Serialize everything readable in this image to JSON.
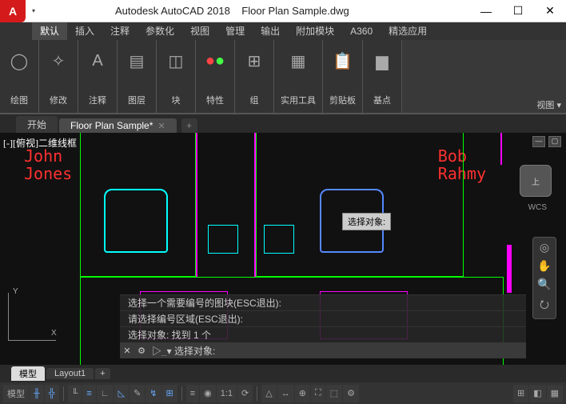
{
  "title": {
    "app": "Autodesk AutoCAD 2018",
    "file": "Floor Plan Sample.dwg"
  },
  "menu": [
    "默认",
    "插入",
    "注释",
    "参数化",
    "视图",
    "管理",
    "输出",
    "附加模块",
    "A360",
    "精选应用"
  ],
  "ribbon": {
    "groups": [
      {
        "label": "绘图"
      },
      {
        "label": "修改"
      },
      {
        "label": "注释"
      },
      {
        "label": "图层"
      },
      {
        "label": "块"
      },
      {
        "label": "特性"
      },
      {
        "label": "组"
      },
      {
        "label": "实用工具"
      },
      {
        "label": "剪贴板"
      },
      {
        "label": "基点"
      }
    ],
    "panel_dd": "视图 ▾"
  },
  "doctabs": {
    "start": "开始",
    "active": "Floor Plan Sample*",
    "add": "+"
  },
  "canvas": {
    "viewtag": "[-][俯视]二维线框",
    "name1": "John\nJones",
    "name2": "Bob\nRahmy",
    "tooltip": "选择对象:",
    "wcs": "WCS",
    "cube": "上",
    "ucs_x": "X",
    "ucs_y": "Y"
  },
  "cmd": {
    "h1": "选择一个需要编号的图块(ESC退出):",
    "h2": "请选择编号区域(ESC退出):",
    "h3": "选择对象: 找到 1 个",
    "prompt": "▷_▾ 选择对象:"
  },
  "layout_tabs": {
    "model": "模型",
    "l1": "Layout1",
    "add": "+"
  },
  "status": {
    "model": "模型",
    "scale": "1:1",
    "items": [
      "╫",
      "╬",
      "╙",
      "≡",
      "∟",
      "◺",
      "✎",
      "↯",
      "⊞",
      "≡",
      "◉",
      "⟳",
      "△",
      "↔",
      "⊕",
      "⛶",
      "⬚",
      "⚙",
      "⊞",
      "◧",
      "▦"
    ]
  }
}
